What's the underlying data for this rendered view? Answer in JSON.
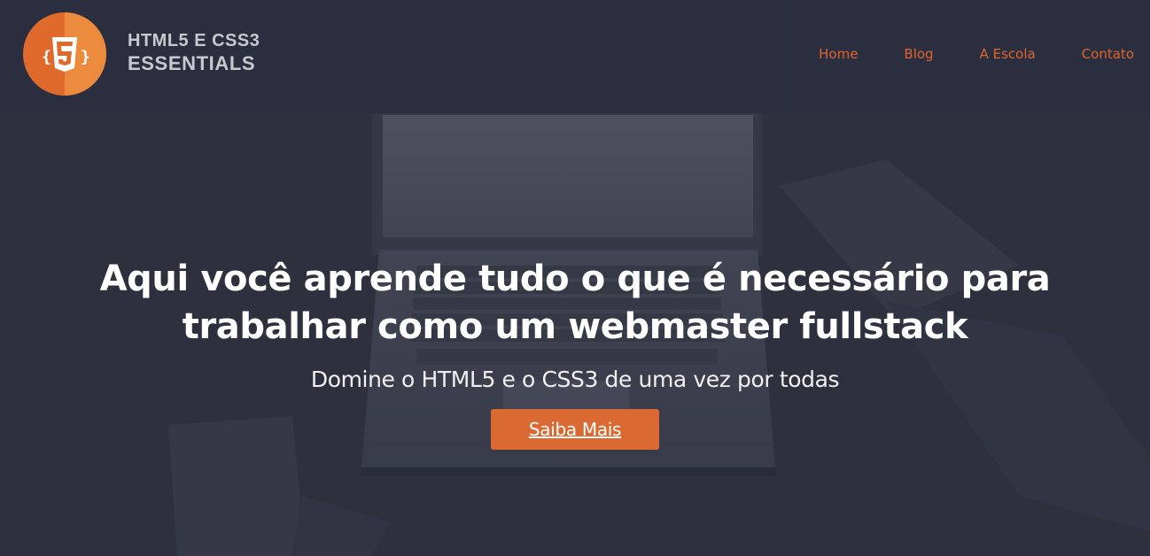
{
  "brand": {
    "logo_icon": "html5-icon",
    "line1": "HTML5 E CSS3",
    "line2": "ESSENTIALS"
  },
  "nav": {
    "items": [
      {
        "label": "Home"
      },
      {
        "label": "Blog"
      },
      {
        "label": "A Escola"
      },
      {
        "label": "Contato"
      }
    ]
  },
  "hero": {
    "title": "Aqui você aprende tudo o que é necessário para trabalhar como um webmaster fullstack",
    "subtitle": "Domine o HTML5 e o CSS3 de uma vez por todas",
    "button_label": "Saiba Mais"
  },
  "colors": {
    "accent": "#e0652c",
    "button": "#db6a32",
    "background": "#2d2f40"
  }
}
